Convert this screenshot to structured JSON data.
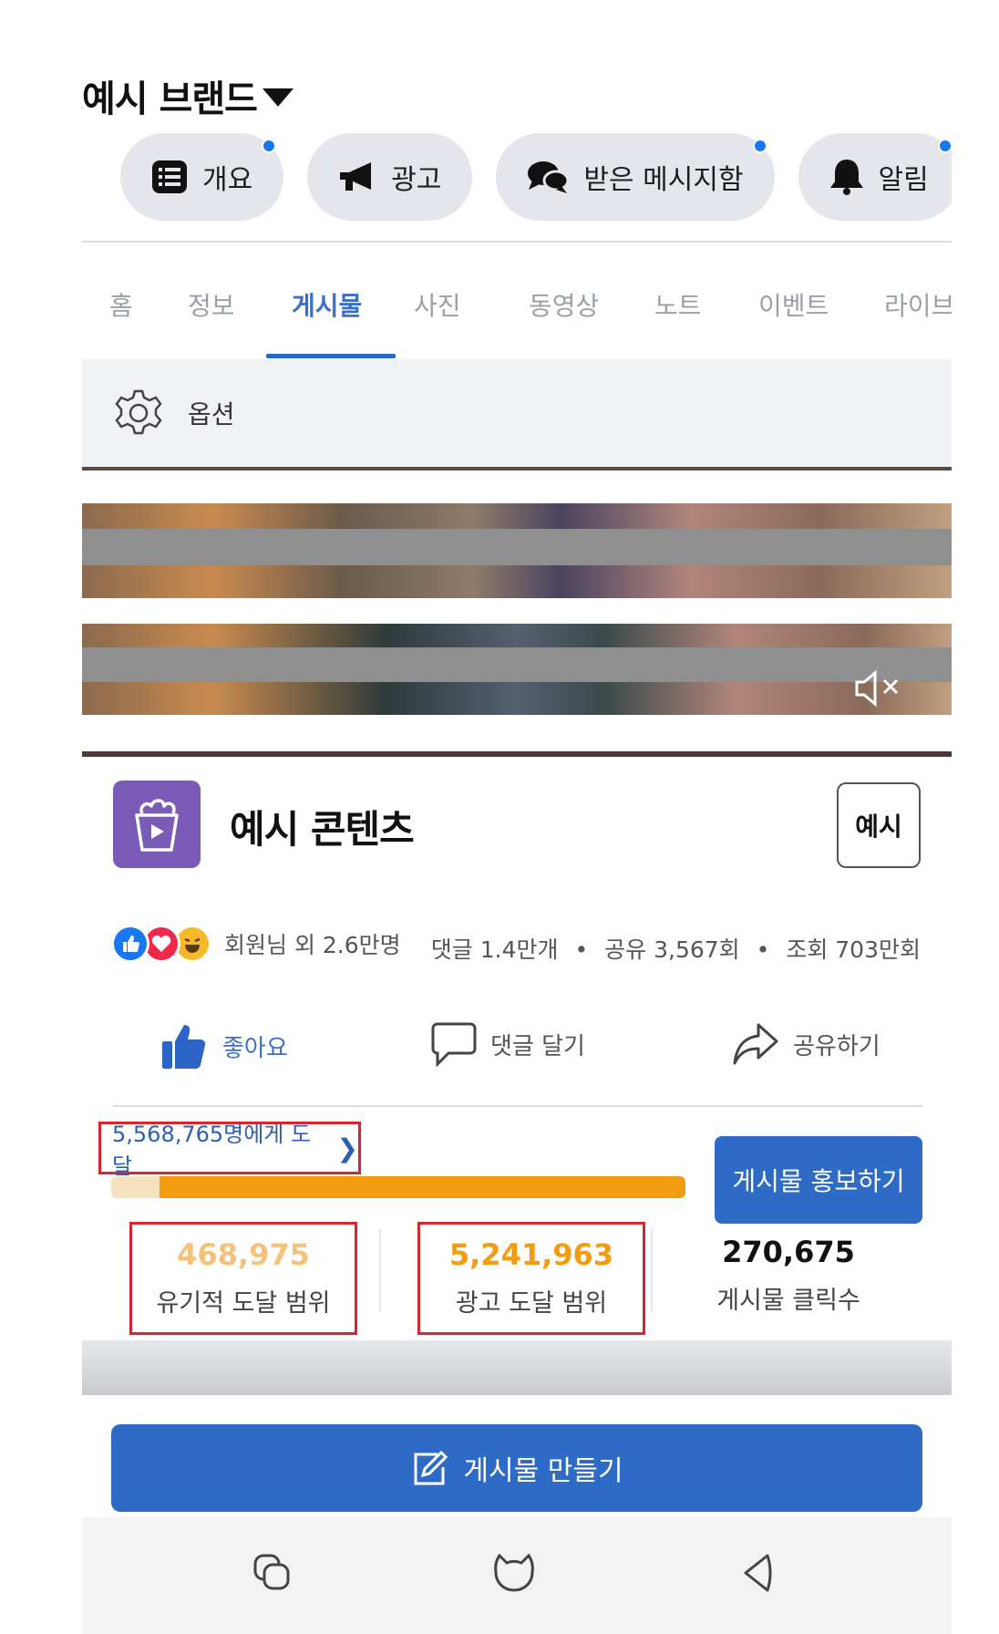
{
  "header": {
    "brand": "예시 브랜드"
  },
  "chips": [
    {
      "label": "개요",
      "icon": "list-icon",
      "badge": true
    },
    {
      "label": "광고",
      "icon": "megaphone-icon",
      "badge": false
    },
    {
      "label": "받은 메시지함",
      "icon": "chat-bubbles-icon",
      "badge": true
    },
    {
      "label": "알림",
      "icon": "bell-icon",
      "badge": true
    }
  ],
  "tabs": [
    "홈",
    "정보",
    "게시물",
    "사진",
    "동영상",
    "노트",
    "이벤트",
    "라이브"
  ],
  "active_tab": "게시물",
  "options": {
    "label": "옵션"
  },
  "post": {
    "title": "예시 콘텐츠",
    "example_button": "예시",
    "reactions_text": "회원님 외 2.6만명",
    "stats": {
      "comments": "댓글 1.4만개",
      "shares": "공유 3,567회",
      "views": "조회 703만회",
      "sep": "•"
    },
    "actions": {
      "like": "좋아요",
      "comment": "댓글 달기",
      "share": "공유하기"
    }
  },
  "insights": {
    "reach_link": "5,568,765명에게 도달",
    "organic_fraction": 0.084,
    "promote_button": "게시물 홍보하기",
    "metrics": [
      {
        "value": "468,975",
        "label": "유기적 도달 범위",
        "color": "#f4c27a"
      },
      {
        "value": "5,241,963",
        "label": "광고 도달 범위",
        "color": "#f39c12"
      },
      {
        "value": "270,675",
        "label": "게시물 클릭수",
        "color": "#111111"
      }
    ]
  },
  "create_post": {
    "label": "게시물 만들기"
  },
  "colors": {
    "accent": "#2e6bc6",
    "highlight_box": "#d9262c",
    "orange": "#f39c12"
  }
}
